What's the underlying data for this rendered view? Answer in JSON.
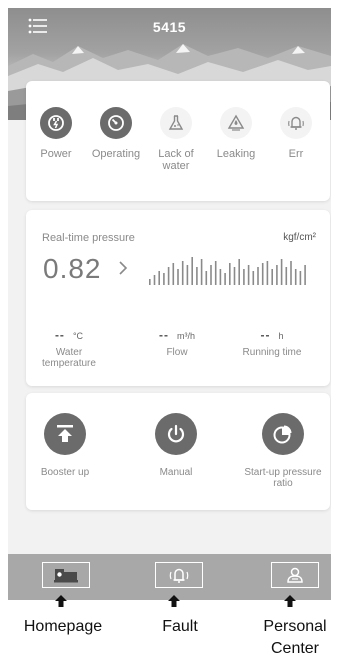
{
  "header": {
    "title": "5415"
  },
  "status": {
    "items": [
      {
        "label": "Power",
        "icon": "power-plug-icon",
        "active": true
      },
      {
        "label": "Operating",
        "icon": "operating-gauge-icon",
        "active": true
      },
      {
        "label": "Lack of water",
        "icon": "flask-icon",
        "active": false
      },
      {
        "label": "Leaking",
        "icon": "leak-icon",
        "active": false
      },
      {
        "label": "Err",
        "icon": "bell-alarm-icon",
        "active": false
      }
    ]
  },
  "pressure": {
    "label": "Real-time pressure",
    "unit": "kgf/cm²",
    "value": "0.82",
    "sparkline": [
      3,
      5,
      7,
      6,
      9,
      11,
      8,
      12,
      10,
      14,
      9,
      13,
      7,
      10,
      12,
      8,
      6,
      11,
      9,
      13,
      8,
      10,
      7,
      9,
      11,
      12,
      8,
      10,
      13,
      9,
      12,
      8,
      7,
      10
    ]
  },
  "metrics": [
    {
      "value": "--",
      "unit": "°C",
      "label": "Water temperature"
    },
    {
      "value": "--",
      "unit": "m³/h",
      "label": "Flow"
    },
    {
      "value": "--",
      "unit": "h",
      "label": "Running time"
    }
  ],
  "controls": [
    {
      "label": "Booster up",
      "icon": "booster-up-icon"
    },
    {
      "label": "Manual",
      "icon": "power-icon"
    },
    {
      "label": "Start-up pressure ratio",
      "icon": "pie-chart-icon"
    }
  ],
  "tabs": [
    {
      "caption": "Homepage",
      "icon": "pump-icon"
    },
    {
      "caption": "Fault",
      "icon": "bell-alarm-icon"
    },
    {
      "caption": "Personal Center",
      "icon": "user-profile-icon"
    }
  ],
  "colors": {
    "dark_icon": "#6b6b6b",
    "tabbar": "#a8a8a8",
    "background": "#f2f2f2"
  }
}
